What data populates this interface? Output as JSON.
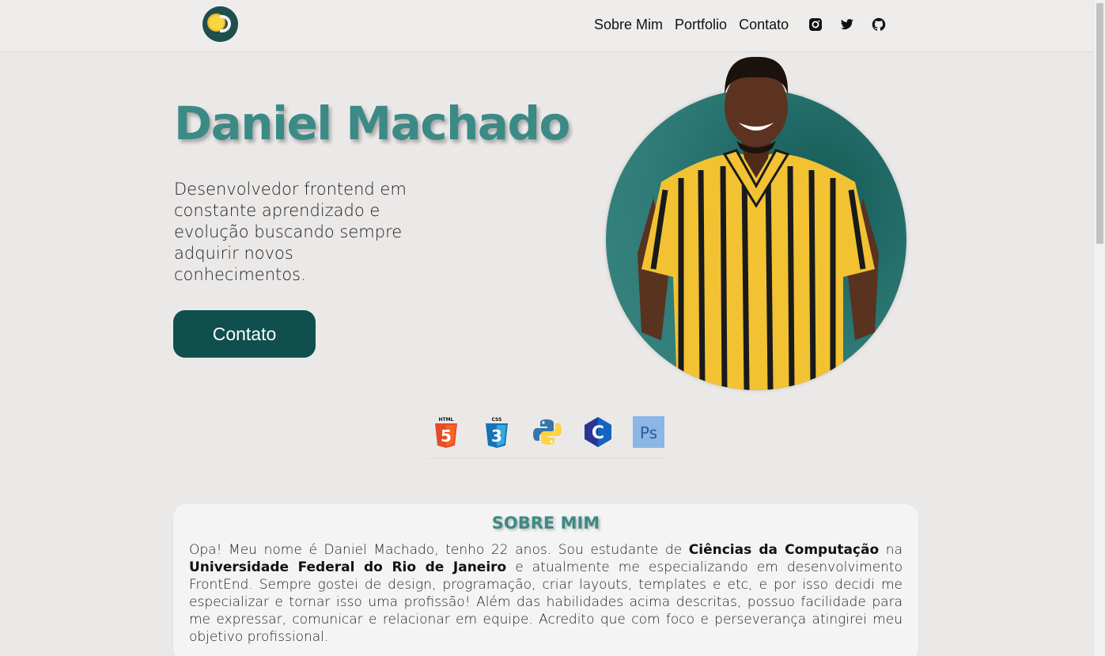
{
  "nav": {
    "items": [
      {
        "label": "Sobre Mim"
      },
      {
        "label": "Portfolio"
      },
      {
        "label": "Contato"
      }
    ],
    "social": [
      "instagram-icon",
      "twitter-icon",
      "github-icon"
    ]
  },
  "hero": {
    "name": "Daniel Machado",
    "description": "Desenvolvedor frontend em constante aprendizado e evolução buscando sempre adquirir novos conhecimentos.",
    "cta_label": "Contato"
  },
  "skills": [
    "html5-icon",
    "css3-icon",
    "python-icon",
    "c-language-icon",
    "photoshop-icon"
  ],
  "about": {
    "title": "SOBRE MIM",
    "text_1": "Opa! Meu nome é Daniel Machado, tenho 22 anos. Sou estudante de ",
    "bold_1": "Ciências da Computação",
    "text_2": " na ",
    "bold_2": "Universidade Federal do Rio de Janeiro",
    "text_3": " e atualmente me especializando em desenvolvimento FrontEnd. Sempre gostei de design, programação, criar layouts, templates e etc, e por isso decidi me especializar e tornar isso uma profissão! Além das habilidades acima descritas, possuo facilidade para me expressar, comunicar e relacionar em equipe. Acredito que com foco e perseverança atingirei meu objetivo profissional."
  },
  "colors": {
    "accent": "#3c8a86",
    "button": "#0f4f4d",
    "background": "#ebe9e8"
  }
}
